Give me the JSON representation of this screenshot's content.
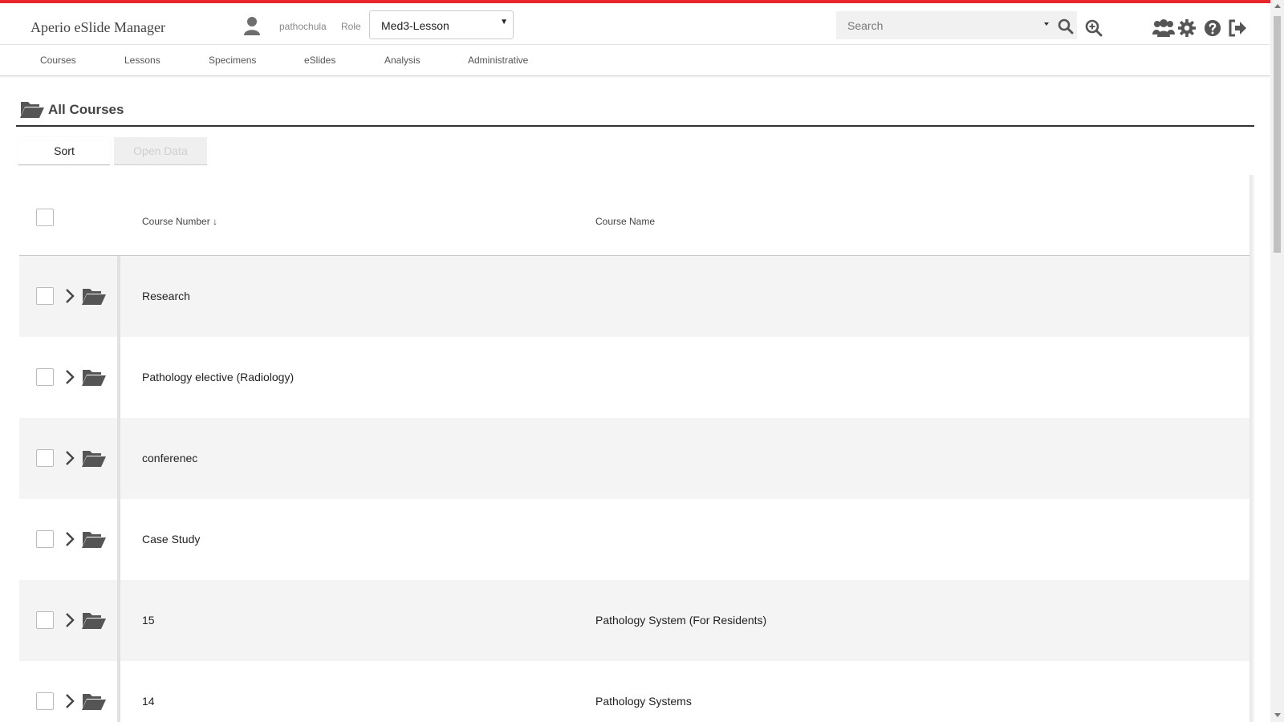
{
  "app": {
    "title": "Aperio eSlide Manager",
    "accent_color": "#e8262b"
  },
  "header": {
    "user_icon": "user-icon",
    "username": "pathochula",
    "role_label": "Role",
    "role_selected": "Med3-Lesson",
    "search_placeholder": "Search",
    "icons": [
      "search-icon",
      "zoom-in-icon",
      "users-icon",
      "gear-icon",
      "help-icon",
      "logout-icon"
    ]
  },
  "nav": {
    "items": [
      {
        "label": "Courses"
      },
      {
        "label": "Lessons"
      },
      {
        "label": "Specimens"
      },
      {
        "label": "eSlides"
      },
      {
        "label": "Analysis"
      },
      {
        "label": "Administrative"
      }
    ]
  },
  "page": {
    "title": "All Courses",
    "title_icon": "folder-open-icon"
  },
  "toolbar": {
    "sort_label": "Sort",
    "open_data_label": "Open Data"
  },
  "table": {
    "columns": [
      "Course Number ↓",
      "Course Name"
    ],
    "rows": [
      {
        "number": "Research",
        "name": ""
      },
      {
        "number": "Pathology elective (Radiology)",
        "name": ""
      },
      {
        "number": "conferenec",
        "name": ""
      },
      {
        "number": "Case Study",
        "name": ""
      },
      {
        "number": "15",
        "name": "Pathology System (For Residents)"
      },
      {
        "number": "14",
        "name": "Pathology Systems"
      }
    ]
  }
}
